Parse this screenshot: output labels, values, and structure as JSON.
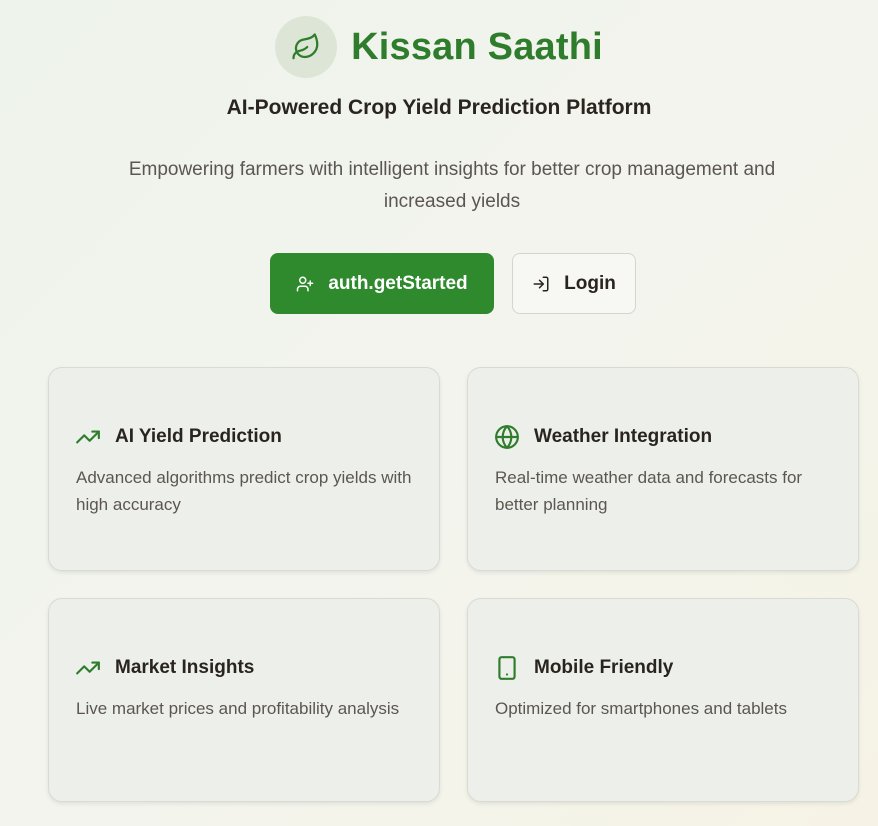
{
  "app": {
    "brand_name": "Kissan Saathi",
    "logo_icon": "leaf-icon",
    "tagline": "AI-Powered Crop Yield Prediction Platform",
    "description": "Empowering farmers with intelligent insights for better crop management and increased yields"
  },
  "actions": {
    "get_started_label": "auth.getStarted",
    "get_started_icon": "user-plus-icon",
    "login_label": "Login",
    "login_icon": "log-in-icon"
  },
  "features": [
    {
      "title": "AI Yield Prediction",
      "description": "Advanced algorithms predict crop yields with high accuracy",
      "icon": "trending-up-icon"
    },
    {
      "title": "Weather Integration",
      "description": "Real-time weather data and forecasts for better planning",
      "icon": "globe-icon"
    },
    {
      "title": "Market Insights",
      "description": "Live market prices and profitability analysis",
      "icon": "trending-up-icon"
    },
    {
      "title": "Mobile Friendly",
      "description": "Optimized for smartphones and tablets",
      "icon": "smartphone-icon"
    }
  ],
  "colors": {
    "brand_green": "#2f7d2c",
    "primary_button": "#2f8a2e",
    "text_dark": "#2a241f",
    "text_muted": "#5c5650"
  }
}
